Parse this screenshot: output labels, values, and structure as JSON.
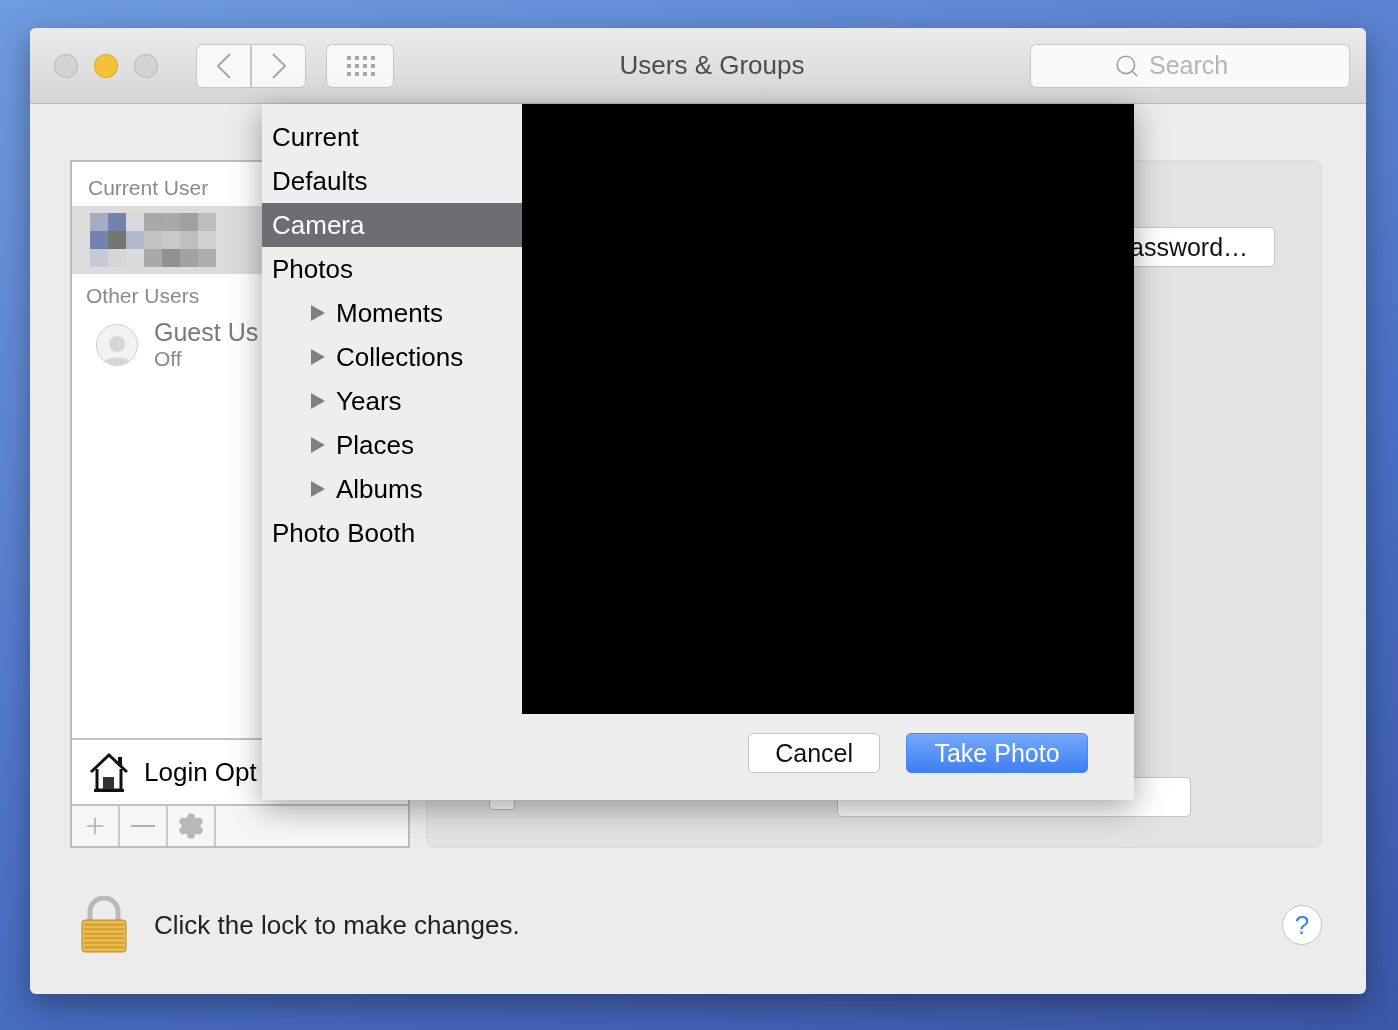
{
  "window": {
    "title": "Users & Groups",
    "buttons": [
      {
        "color": "#d3d3d3"
      },
      {
        "color": "#f4c13b"
      },
      {
        "color": "#d3d3d3"
      }
    ]
  },
  "search": {
    "placeholder": "Search"
  },
  "users": {
    "current_header": "Current User",
    "current": [
      {
        "kind": "picture",
        "selected": true
      }
    ],
    "other_header": "Other Users",
    "others": [
      {
        "name": "Guest Us",
        "status": "Off",
        "selected": false
      }
    ],
    "login_options": "Login Opt"
  },
  "details": {
    "password_button": "assword…",
    "parental_controls": {
      "checked": false
    }
  },
  "photo_picker": {
    "sources": [
      {
        "label": "Current",
        "selected": false
      },
      {
        "label": "Defaults",
        "selected": false
      },
      {
        "label": "Camera",
        "selected": true
      },
      {
        "label": "Photos",
        "selected": false,
        "children": [
          {
            "label": "Moments",
            "selected": false,
            "expanded": false
          },
          {
            "label": "Collections",
            "selected": false,
            "expanded": false
          },
          {
            "label": "Years",
            "selected": false,
            "expanded": false
          },
          {
            "label": "Places",
            "selected": false,
            "expanded": false
          },
          {
            "label": "Albums",
            "selected": false,
            "expanded": false
          }
        ]
      },
      {
        "label": "Photo Booth",
        "selected": false
      }
    ],
    "buttons": [
      {
        "label": "Cancel",
        "primary": false
      },
      {
        "label": "Take Photo",
        "primary": true
      }
    ]
  },
  "lock": {
    "message": "Click the lock to make changes."
  },
  "help": "?"
}
